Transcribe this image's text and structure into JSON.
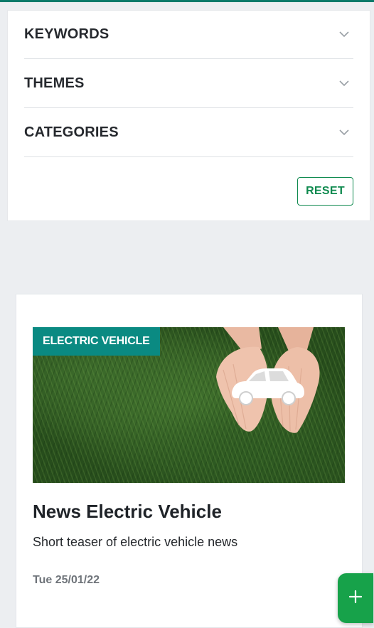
{
  "filters": {
    "items": [
      {
        "label": "KEYWORDS",
        "icon": "chevron-down-icon"
      },
      {
        "label": "THEMES",
        "icon": "chevron-down-icon"
      },
      {
        "label": "CATEGORIES",
        "icon": "chevron-down-icon"
      }
    ],
    "reset_label": "RESET"
  },
  "card": {
    "badge": "ELECTRIC VEHICLE",
    "title": "News Electric Vehicle",
    "teaser": "Short teaser of electric vehicle news",
    "date": "Tue 25/01/22"
  },
  "fab": {
    "icon": "plus-icon"
  },
  "colors": {
    "accent_green": "#0f8a4f",
    "badge_teal": "#0a8a82",
    "fab_green": "#17a24a",
    "top_border": "#0a7a6a"
  }
}
